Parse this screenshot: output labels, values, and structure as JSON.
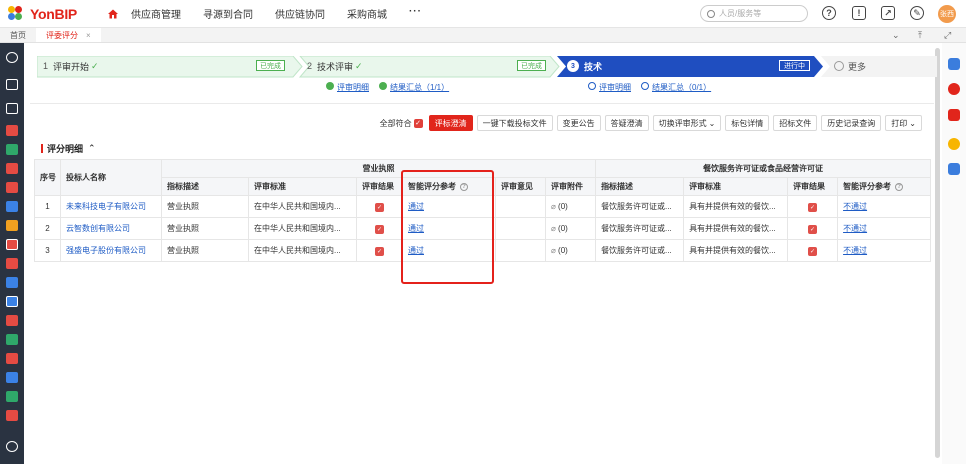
{
  "app": {
    "logo": "YonBIP"
  },
  "nav": [
    "供应商管理",
    "寻源到合同",
    "供应链协同",
    "采购商城",
    "···"
  ],
  "search": {
    "placeholder": "人员/服务等"
  },
  "user": {
    "avatar_text": "张西"
  },
  "tabs": [
    {
      "label": "首页"
    },
    {
      "label": "评委评分",
      "close": "×"
    }
  ],
  "steps": [
    {
      "num": "1",
      "label": "评审开始",
      "badge": "已完成"
    },
    {
      "num": "2",
      "label": "技术评审",
      "badge": "已完成"
    },
    {
      "num": "3",
      "label": "技术",
      "badge": "进行中"
    },
    {
      "label": "更多"
    }
  ],
  "sublinks2": [
    "评审明细",
    "结果汇总（1/1）"
  ],
  "sublinks3": [
    "评审明细",
    "结果汇总（0/1）"
  ],
  "toolbar": {
    "all_match": "全部符合",
    "buttons": [
      "评标澄清",
      "一键下载投标文件",
      "变更公告",
      "答疑澄清",
      "切换评审形式",
      "标包详情",
      "招标文件",
      "历史记录查询",
      "打印"
    ]
  },
  "section": {
    "title": "评分明细"
  },
  "table": {
    "group1": "营业执照",
    "group2": "餐饮服务许可证或食品经营许可证",
    "headers": {
      "seq": "序号",
      "bidder": "投标人名称",
      "indicator": "指标描述",
      "standard": "评审标准",
      "result": "评审结果",
      "ai_ref": "智能评分参考",
      "opinion": "评审意见",
      "attach": "评审附件"
    },
    "rows": [
      {
        "seq": "1",
        "bidder": "未来科技电子有限公司",
        "ind1": "营业执照",
        "std1": "在中华人民共和国境内...",
        "ai1": "通过",
        "att": "(0)",
        "ind2": "餐饮服务许可证或...",
        "std2": "具有并提供有效的餐饮...",
        "ai2": "不通过"
      },
      {
        "seq": "2",
        "bidder": "云智数创有限公司",
        "ind1": "营业执照",
        "std1": "在中华人民共和国境内...",
        "ai1": "通过",
        "att": "(0)",
        "ind2": "餐饮服务许可证或...",
        "std2": "具有并提供有效的餐饮...",
        "ai2": "不通过"
      },
      {
        "seq": "3",
        "bidder": "强盛电子股份有限公司",
        "ind1": "营业执照",
        "std1": "在中华人民共和国境内...",
        "ai1": "通过",
        "att": "(0)",
        "ind2": "餐饮服务许可证或...",
        "std2": "具有并提供有效的餐饮...",
        "ai2": "不通过"
      }
    ]
  }
}
